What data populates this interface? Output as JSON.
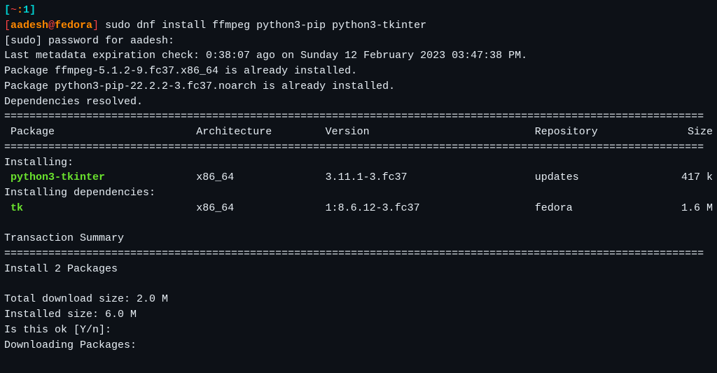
{
  "prompt_tab": {
    "open": "[",
    "tilde": "~",
    "colon": ":",
    "num": "1",
    "close": "]"
  },
  "prompt_user": {
    "open": "[",
    "user": "aadesh",
    "at": "@",
    "host": "fedora",
    "close": "]"
  },
  "command": " sudo dnf install ffmpeg python3-pip python3-tkinter",
  "sudo_prompt": "[sudo] password for aadesh:",
  "metadata_line": "Last metadata expiration check: 0:38:07 ago on Sunday 12 February 2023 03:47:38 PM.",
  "already1": "Package ffmpeg-5.1.2-9.fc37.x86_64 is already installed.",
  "already2": "Package python3-pip-22.2.2-3.fc37.noarch is already installed.",
  "resolved": "Dependencies resolved.",
  "sep": "===============================================================================================================",
  "headers": {
    "pkg": " Package",
    "arch": "Architecture",
    "ver": "Version",
    "repo": "Repository",
    "size": "Size"
  },
  "installing_label": "Installing:",
  "installing_deps_label": "Installing dependencies:",
  "rows": [
    {
      "pkg": " python3-tkinter",
      "arch": "x86_64",
      "ver": "3.11.1-3.fc37",
      "repo": "updates",
      "size": "417 k"
    },
    {
      "pkg": " tk",
      "arch": "x86_64",
      "ver": "1:8.6.12-3.fc37",
      "repo": "fedora",
      "size": "1.6 M"
    }
  ],
  "tx_summary": "Transaction Summary",
  "install_count": "Install  2 Packages",
  "total_download": "Total download size: 2.0 M",
  "installed_size": "Installed size: 6.0 M",
  "confirm": "Is this ok [Y/n]:",
  "downloading": "Downloading Packages:"
}
